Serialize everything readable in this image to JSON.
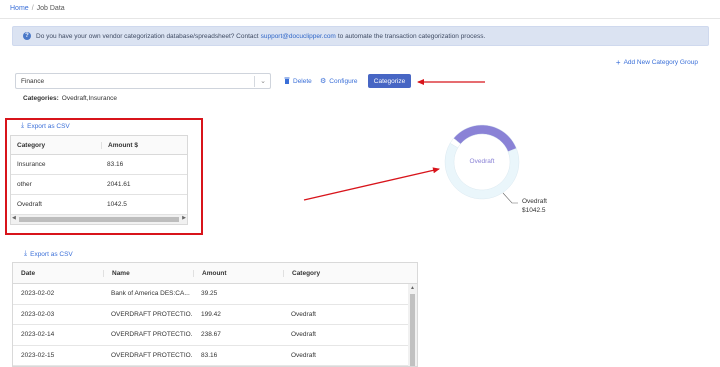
{
  "breadcrumb": {
    "home": "Home",
    "sep": "/",
    "current": "Job Data"
  },
  "alert": {
    "text_before": "Do you have your own vendor categorization database/spreadsheet? Contact",
    "email": "support@docuclipper.com",
    "text_after": "to automate the transaction categorization process."
  },
  "add_group": "Add New Category Group",
  "toolbar": {
    "select_value": "Finance",
    "delete_label": "Delete",
    "configure_label": "Configure",
    "categorize_label": "Categorize"
  },
  "categories": {
    "label": "Categories:",
    "value": "Ovedraft,Insurance"
  },
  "summary": {
    "export_label": "Export as CSV",
    "headers": [
      "Category",
      "Amount $"
    ],
    "rows": [
      [
        "Insurance",
        "83.16"
      ],
      [
        "other",
        "2041.61"
      ],
      [
        "Ovedraft",
        "1042.5"
      ]
    ]
  },
  "chart_data": {
    "type": "pie",
    "title": "",
    "center_label": "Ovedraft",
    "slices": [
      {
        "label": "Ovedraft",
        "value": 1042.5,
        "color": "#8a82d6"
      },
      {
        "label": "other",
        "value": 2041.61,
        "color": "#eaf6fb"
      },
      {
        "label": "Insurance",
        "value": 83.16,
        "color": "#ffffff"
      }
    ],
    "callout": {
      "label": "Ovedraft",
      "value_text": "$1042.5"
    }
  },
  "transactions": {
    "export_label": "Export as CSV",
    "headers": {
      "date": "Date",
      "name": "Name",
      "amount": "Amount",
      "category": "Category"
    },
    "rows": [
      {
        "date": "2023-02-02",
        "name": "Bank of America DES:CA...",
        "amount": "39.25",
        "category": ""
      },
      {
        "date": "2023-02-03",
        "name": "OVERDRAFT PROTECTIO...",
        "amount": "199.42",
        "category": "Ovedraft"
      },
      {
        "date": "2023-02-14",
        "name": "OVERDRAFT PROTECTIO...",
        "amount": "238.67",
        "category": "Ovedraft"
      },
      {
        "date": "2023-02-15",
        "name": "OVERDRAFT PROTECTIO...",
        "amount": "83.16",
        "category": "Ovedraft"
      }
    ]
  },
  "colors": {
    "accent": "#3a6fd8",
    "button": "#4766c4",
    "highlight": "#d8141b",
    "alert_bg": "#dbe3f2"
  }
}
